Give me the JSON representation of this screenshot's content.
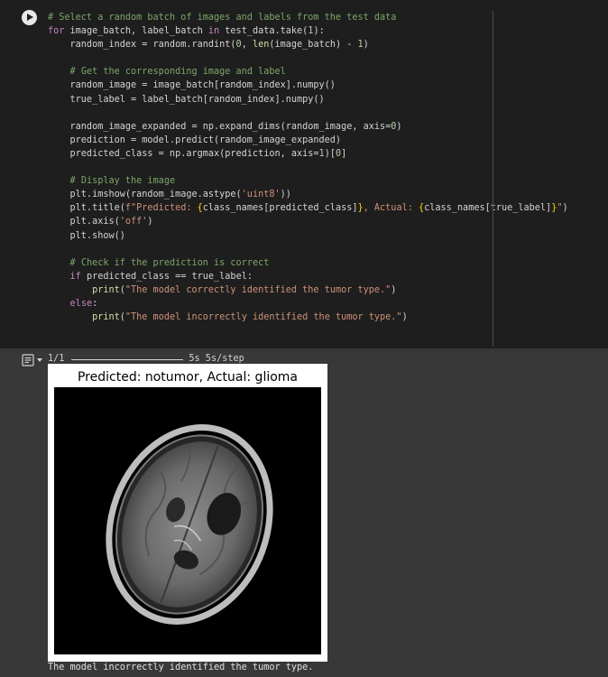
{
  "code_lines": [
    [
      {
        "t": "# Select a random batch of images and labels from the test data",
        "c": "cm"
      }
    ],
    [
      {
        "t": "for",
        "c": "kw"
      },
      {
        "t": " image_batch, label_batch "
      },
      {
        "t": "in",
        "c": "kw"
      },
      {
        "t": " test_data.take("
      },
      {
        "t": "1",
        "c": "nm"
      },
      {
        "t": "):"
      }
    ],
    [
      {
        "t": "    random_index = random.randint("
      },
      {
        "t": "0",
        "c": "nm"
      },
      {
        "t": ", "
      },
      {
        "t": "len",
        "c": "fn"
      },
      {
        "t": "(image_batch) - "
      },
      {
        "t": "1",
        "c": "nm"
      },
      {
        "t": ")"
      }
    ],
    [],
    [
      {
        "t": "    "
      },
      {
        "t": "# Get the corresponding image and label",
        "c": "cm"
      }
    ],
    [
      {
        "t": "    random_image = image_batch[random_index].numpy()"
      }
    ],
    [
      {
        "t": "    true_label = label_batch[random_index].numpy()"
      }
    ],
    [],
    [
      {
        "t": "    random_image_expanded = np.expand_dims(random_image, axis="
      },
      {
        "t": "0",
        "c": "nm"
      },
      {
        "t": ")"
      }
    ],
    [
      {
        "t": "    prediction = model.predict(random_image_expanded)"
      }
    ],
    [
      {
        "t": "    predicted_class = np.argmax(prediction, axis="
      },
      {
        "t": "1",
        "c": "nm"
      },
      {
        "t": ")["
      },
      {
        "t": "0",
        "c": "nm"
      },
      {
        "t": "]"
      }
    ],
    [],
    [
      {
        "t": "    "
      },
      {
        "t": "# Display the image",
        "c": "cm"
      }
    ],
    [
      {
        "t": "    plt.imshow(random_image.astype("
      },
      {
        "t": "'uint8'",
        "c": "st"
      },
      {
        "t": "))"
      }
    ],
    [
      {
        "t": "    plt.title("
      },
      {
        "t": "f\"Predicted: ",
        "c": "st"
      },
      {
        "t": "{",
        "c": "br"
      },
      {
        "t": "class_names[predicted_class]"
      },
      {
        "t": "}",
        "c": "br"
      },
      {
        "t": ", Actual: ",
        "c": "st"
      },
      {
        "t": "{",
        "c": "br"
      },
      {
        "t": "class_names[true_label]"
      },
      {
        "t": "}",
        "c": "br"
      },
      {
        "t": "\"",
        "c": "st"
      },
      {
        "t": ")"
      }
    ],
    [
      {
        "t": "    plt.axis("
      },
      {
        "t": "'off'",
        "c": "st"
      },
      {
        "t": ")"
      }
    ],
    [
      {
        "t": "    plt.show()"
      }
    ],
    [],
    [
      {
        "t": "    "
      },
      {
        "t": "# Check if the prediction is correct",
        "c": "cm"
      }
    ],
    [
      {
        "t": "    "
      },
      {
        "t": "if",
        "c": "kw"
      },
      {
        "t": " predicted_class == true_label:"
      }
    ],
    [
      {
        "t": "        "
      },
      {
        "t": "print",
        "c": "fn"
      },
      {
        "t": "("
      },
      {
        "t": "\"The model correctly identified the tumor type.\"",
        "c": "st"
      },
      {
        "t": ")"
      }
    ],
    [
      {
        "t": "    "
      },
      {
        "t": "else",
        "c": "kw"
      },
      {
        "t": ":"
      }
    ],
    [
      {
        "t": "        "
      },
      {
        "t": "print",
        "c": "fn"
      },
      {
        "t": "("
      },
      {
        "t": "\"The model incorrectly identified the tumor type.\"",
        "c": "st"
      },
      {
        "t": ")"
      }
    ]
  ],
  "output": {
    "progress_count": "1/1",
    "progress_timing": "5s 5s/step",
    "figure_title": "Predicted: notumor, Actual: glioma",
    "printed_text": "The model incorrectly identified the tumor type."
  },
  "colors": {
    "cell_bg": "#1e1e1e",
    "output_bg": "#383838",
    "comment": "#7ca668",
    "keyword": "#c586c0",
    "number": "#b5cea8",
    "string": "#ce9178"
  },
  "icons": {
    "run": "play-circle-icon",
    "output_toggle": "output-collapse-icon"
  }
}
